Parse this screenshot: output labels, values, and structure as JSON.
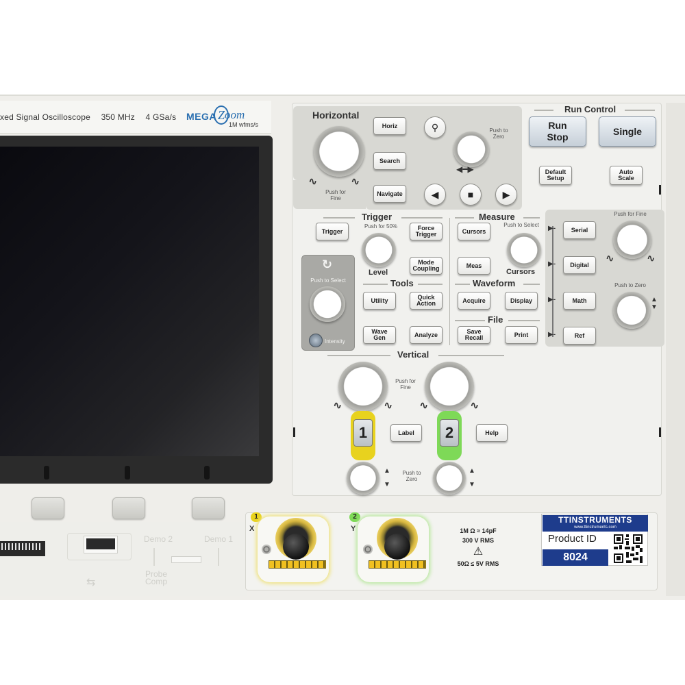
{
  "model": {
    "name": "xed Signal Oscilloscope",
    "bandwidth": "350 MHz",
    "sample_rate": "4 GSa/s",
    "logo_mega": "MEGA",
    "logo_zoom": "oom",
    "logo_z": "Z",
    "logo_sub": "1M wfms/s"
  },
  "horizontal": {
    "title": "Horizontal",
    "push_for_fine": "Push for\nFine",
    "push_to_zero": "Push to\nZero",
    "horiz": "Horiz",
    "search": "Search",
    "navigate": "Navigate",
    "zoom_glyph": "⚲",
    "prev_glyph": "◀",
    "stop_glyph": "■",
    "next_glyph": "▶"
  },
  "run_control": {
    "title": "Run Control",
    "run_stop": "Run\nStop",
    "single": "Single",
    "default_setup": "Default\nSetup",
    "auto_scale": "Auto\nScale"
  },
  "trigger": {
    "title": "Trigger",
    "push_for_50": "Push for 50%",
    "trigger_btn": "Trigger",
    "force_trigger": "Force\nTrigger",
    "level": "Level",
    "mode_coupling": "Mode\nCoupling"
  },
  "intensity": {
    "push_to_select": "Push to Select",
    "label": "Intensity"
  },
  "measure": {
    "title": "Measure",
    "push_to_select": "Push to Select",
    "cursors_btn": "Cursors",
    "meas": "Meas",
    "cursors_label": "Cursors"
  },
  "tools": {
    "title": "Tools",
    "utility": "Utility",
    "quick_action": "Quick\nAction",
    "wave_gen": "Wave\nGen",
    "analyze": "Analyze"
  },
  "waveform": {
    "title": "Waveform",
    "acquire": "Acquire",
    "display": "Display"
  },
  "file": {
    "title": "File",
    "save_recall": "Save\nRecall",
    "print": "Print"
  },
  "source": {
    "push_for_fine": "Push for Fine",
    "push_to_zero": "Push to Zero",
    "serial": "Serial",
    "digital": "Digital",
    "math": "Math",
    "ref": "Ref"
  },
  "vertical": {
    "title": "Vertical",
    "push_for_fine": "Push for\nFine",
    "push_to_zero": "Push to\nZero",
    "ch1": "1",
    "ch2": "2",
    "label": "Label",
    "help": "Help"
  },
  "inputs": {
    "ch1_tag": "1",
    "ch2_tag": "2",
    "ch1_axis": "X",
    "ch2_axis": "Y",
    "spec_line1": "1M Ω ≈ 14pF",
    "spec_line2": "300 V RMS",
    "warning": "⚠",
    "spec_line3": "50Ω ≤ 5V RMS"
  },
  "front_io": {
    "demo2": "Demo 2",
    "demo1": "Demo 1",
    "probe_comp": "Probe\nComp",
    "usb_symbol": "⇆"
  },
  "sticker": {
    "brand": "TTINSTRUMENTS",
    "site": "www.ttinstruments.com",
    "product_label": "Product ID",
    "product_id": "8024"
  },
  "colors": {
    "ch1": "#e8d21e",
    "ch2": "#7ed957",
    "brand_blue": "#1e3c8c"
  }
}
